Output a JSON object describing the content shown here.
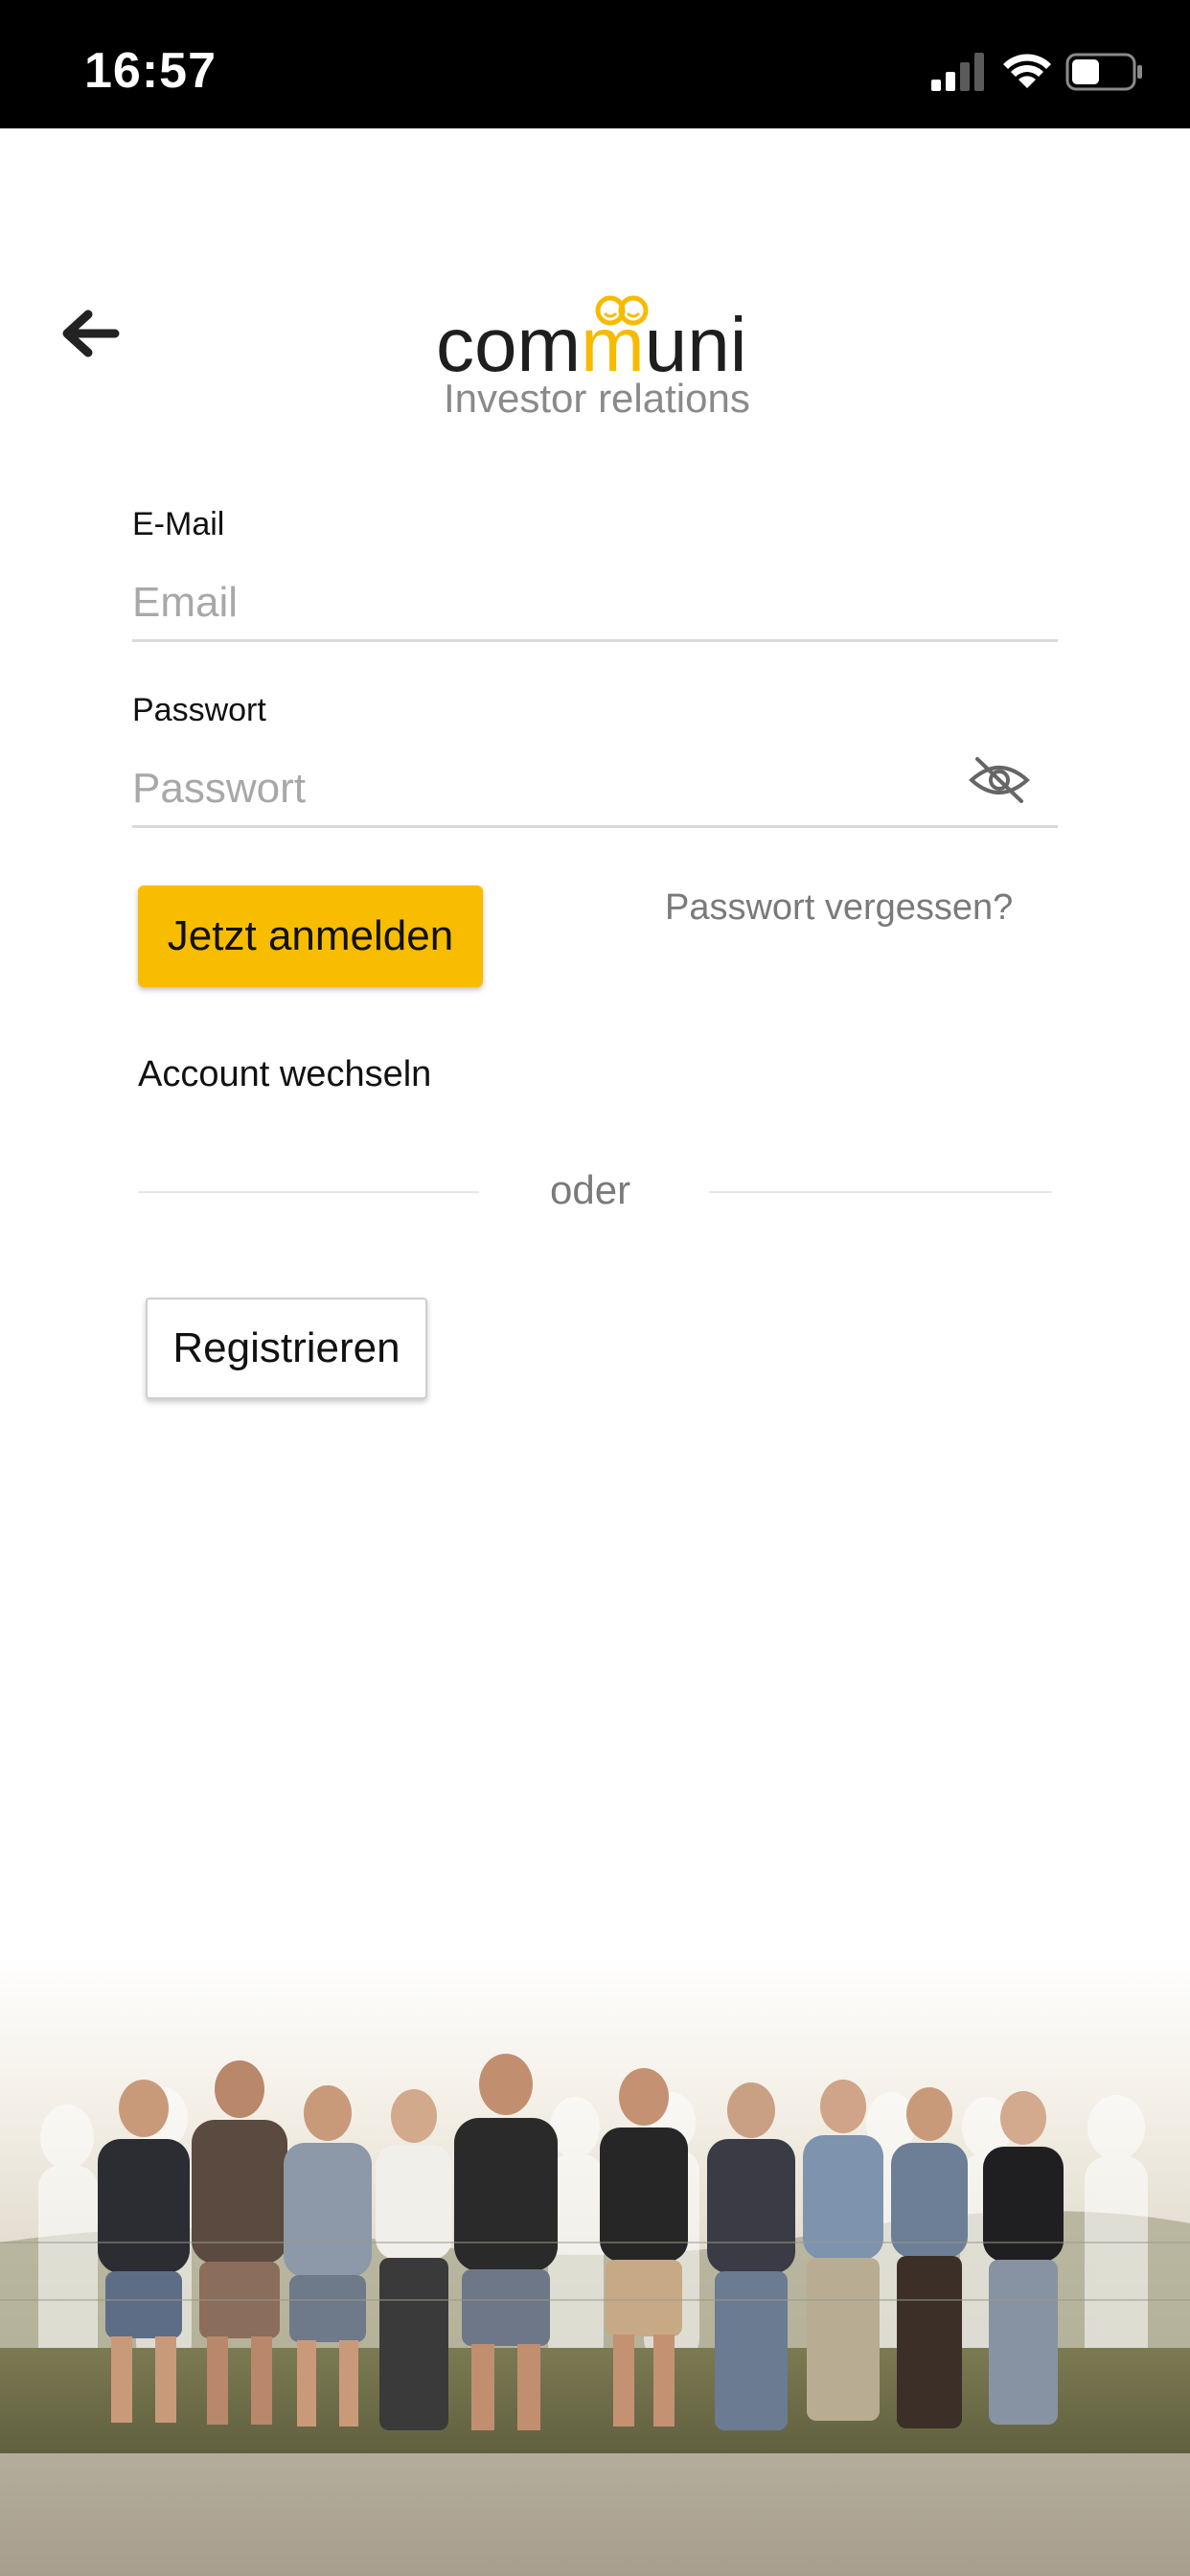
{
  "status_bar": {
    "time": "16:57",
    "icons": [
      "signal-icon",
      "wifi-icon",
      "battery-icon"
    ]
  },
  "header": {
    "back_icon": "arrow-left-icon",
    "logo": {
      "word_start": "com",
      "word_m": "m",
      "word_end": "uni",
      "subtitle": "Investor relations"
    }
  },
  "form": {
    "email": {
      "label": "E-Mail",
      "placeholder": "Email",
      "value": ""
    },
    "password": {
      "label": "Passwort",
      "placeholder": "Passwort",
      "value": "",
      "toggle_icon": "eye-slash-icon"
    },
    "login_label": "Jetzt anmelden",
    "forgot_label": "Passwort vergessen?",
    "switch_account_label": "Account wechseln",
    "divider_label": "oder",
    "register_label": "Registrieren"
  },
  "colors": {
    "accent": "#f8bd00",
    "status_bar_bg": "#000000",
    "muted_text": "#7a7a7a"
  }
}
